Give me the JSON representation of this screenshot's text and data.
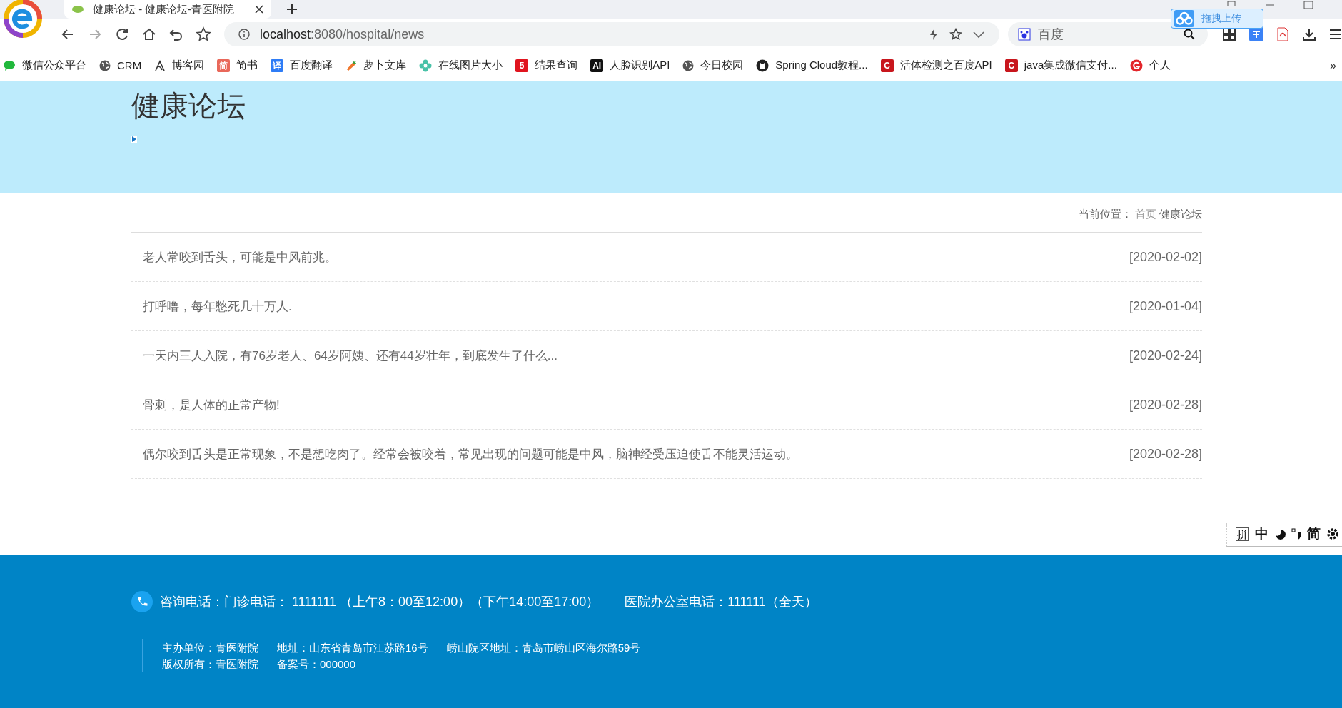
{
  "browser": {
    "tab_title": "健康论坛 - 健康论坛-青医附院",
    "url_host": "localhost",
    "url_path": ":8080/hospital/news",
    "search_placeholder": "百度",
    "upload_label": "拖拽上传",
    "bookmarks": [
      {
        "label": "微信公众平台",
        "kind": "chat"
      },
      {
        "label": "CRM",
        "kind": "globe"
      },
      {
        "label": "博客园",
        "kind": "pen"
      },
      {
        "label": "简书",
        "kind": "letter",
        "icon_text": "简",
        "color": "#e9685a"
      },
      {
        "label": "百度翻译",
        "kind": "letter",
        "icon_text": "译",
        "color": "#2e7cf6"
      },
      {
        "label": "萝卜文库",
        "kind": "carrot"
      },
      {
        "label": "在线图片大小",
        "kind": "flower"
      },
      {
        "label": "结果查询",
        "kind": "letter",
        "icon_text": "5",
        "color": "#e0141e"
      },
      {
        "label": "人脸识别API",
        "kind": "letter",
        "icon_text": "AI",
        "color": "#111111"
      },
      {
        "label": "今日校园",
        "kind": "globe"
      },
      {
        "label": "Spring Cloud教程...",
        "kind": "github"
      },
      {
        "label": "活体检测之百度API",
        "kind": "letter",
        "icon_text": "C",
        "color": "#c8161d"
      },
      {
        "label": "java集成微信支付...",
        "kind": "letter",
        "icon_text": "C",
        "color": "#c8161d"
      },
      {
        "label": "个人",
        "kind": "ring"
      }
    ],
    "more": "»"
  },
  "header": {
    "title": "健康论坛"
  },
  "breadcrumb": {
    "label": "当前位置：",
    "home": "首页",
    "current": "健康论坛"
  },
  "news": [
    {
      "title": "老人常咬到舌头，可能是中风前兆。",
      "date": "[2020-02-02]"
    },
    {
      "title": "打呼噜，每年憋死几十万人.",
      "date": "[2020-01-04]"
    },
    {
      "title": "一天内三人入院，有76岁老人、64岁阿姨、还有44岁壮年，到底发生了什么...",
      "date": "[2020-02-24]"
    },
    {
      "title": "骨刺，是人体的正常产物!",
      "date": "[2020-02-28]"
    },
    {
      "title": "偶尔咬到舌头是正常现象，不是想吃肉了。经常会被咬着，常见出现的问题可能是中风，脑神经受压迫使舌不能灵活运动。",
      "date": "[2020-02-28]"
    }
  ],
  "ime": {
    "mode": "拼",
    "lang": "中",
    "script": "简"
  },
  "footer": {
    "phone": "咨询电话：门诊电话： 1111111 （上午8：00至12:00）（下午14:00至17:00）",
    "office": "医院办公室电话：111111（全天）",
    "lines": [
      [
        "主办单位：青医附院",
        "地址：山东省青岛市江苏路16号",
        "崂山院区地址：青岛市崂山区海尔路59号"
      ],
      [
        "版权所有：青医附院",
        "备案号：000000"
      ]
    ]
  }
}
